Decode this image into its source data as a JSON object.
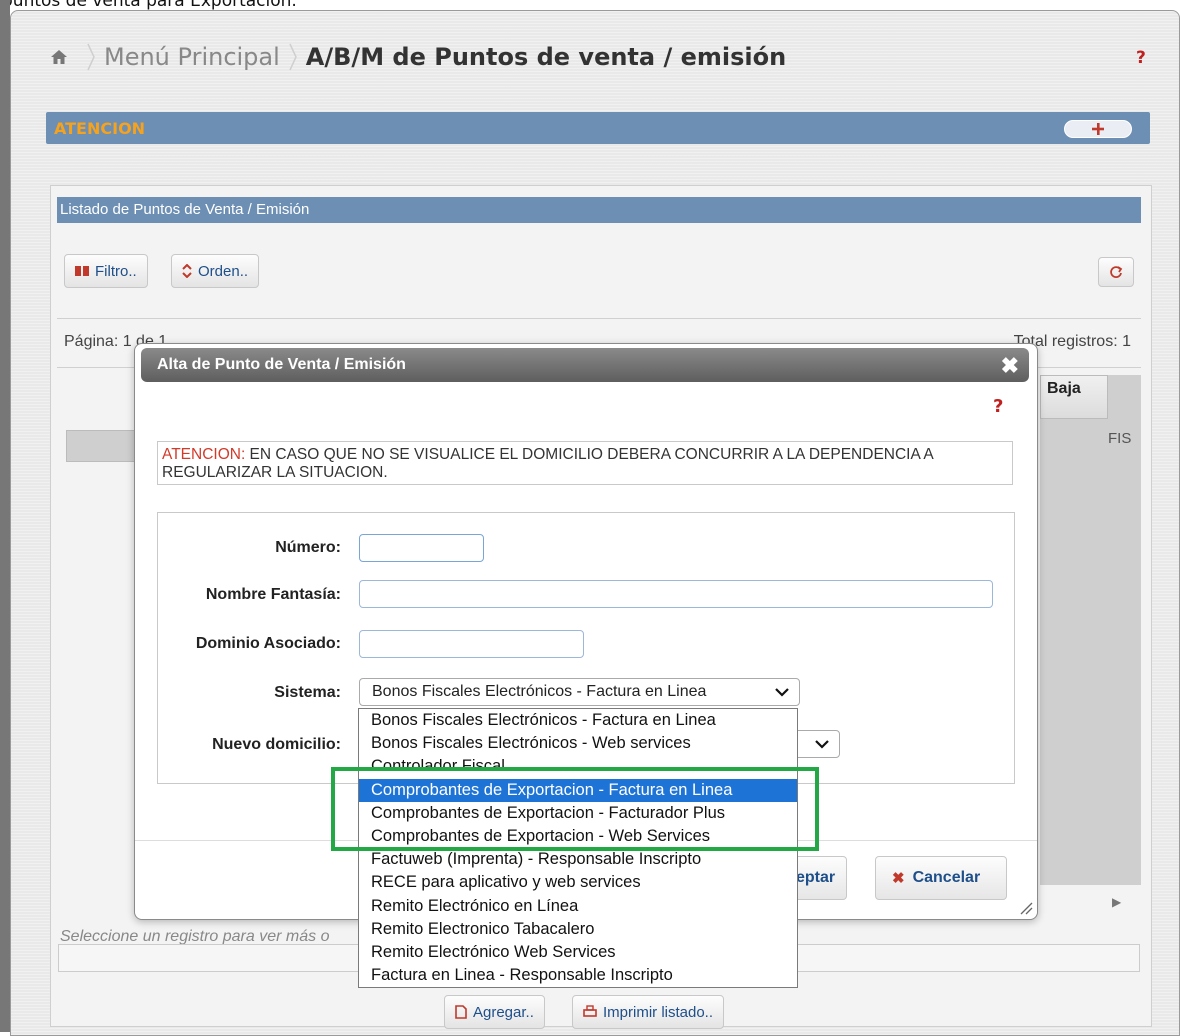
{
  "caption": "puntos de venta para Exportación.",
  "breadcrumb": {
    "root": "Menú Principal",
    "current": "A/B/M de Puntos de venta / emisión"
  },
  "help_symbol": "?",
  "atencion_bar": {
    "label": "ATENCION",
    "toggle": "+"
  },
  "listado": {
    "title": "Listado de Puntos de Venta / Emisión",
    "filtro": "Filtro..",
    "orden": "Orden..",
    "pagina": "Página: 1 de 1",
    "total": "Total registros: 1",
    "baja_header": "Baja",
    "cell_fis": "FIS",
    "select_hint": "Seleccione un registro para ver más o"
  },
  "bottom": {
    "agregar": "Agregar..",
    "imprimir": "Imprimir listado.."
  },
  "modal": {
    "title": "Alta de Punto de Venta / Emisión",
    "close": "✖",
    "alert_prefix": "ATENCION:",
    "alert_text": " EN CASO QUE NO SE VISUALICE EL DOMICILIO DEBERA CONCURRIR A LA DEPENDENCIA A REGULARIZAR LA SITUACION.",
    "labels": {
      "numero": "Número:",
      "nombre": "Nombre Fantasía:",
      "dominio": "Dominio Asociado:",
      "sistema": "Sistema:",
      "domicilio": "Nuevo domicilio:"
    },
    "sistema_selected": "Bonos Fiscales Electrónicos - Factura en Linea",
    "aceptar": "eptar",
    "cancelar": "Cancelar"
  },
  "dropdown_options": [
    "Bonos Fiscales Electrónicos - Factura en Linea",
    "Bonos Fiscales Electrónicos - Web services",
    "Controlador Fiscal",
    "Comprobantes de Exportacion - Factura en Linea",
    "Comprobantes de Exportacion - Facturador Plus",
    "Comprobantes de Exportacion - Web Services",
    "Factuweb (Imprenta) - Responsable Inscripto",
    "RECE para aplicativo y web services",
    "Remito Electrónico en Línea",
    "Remito Electronico Tabacalero",
    "Remito Electrónico Web Services",
    "Factura en Linea - Responsable Inscripto"
  ],
  "dropdown_selected_index": 3,
  "colors": {
    "header_blue": "#6d8fb4",
    "select_blue": "#1e74d6",
    "highlight_green": "#22a844",
    "warn_red": "#d23a2a"
  }
}
